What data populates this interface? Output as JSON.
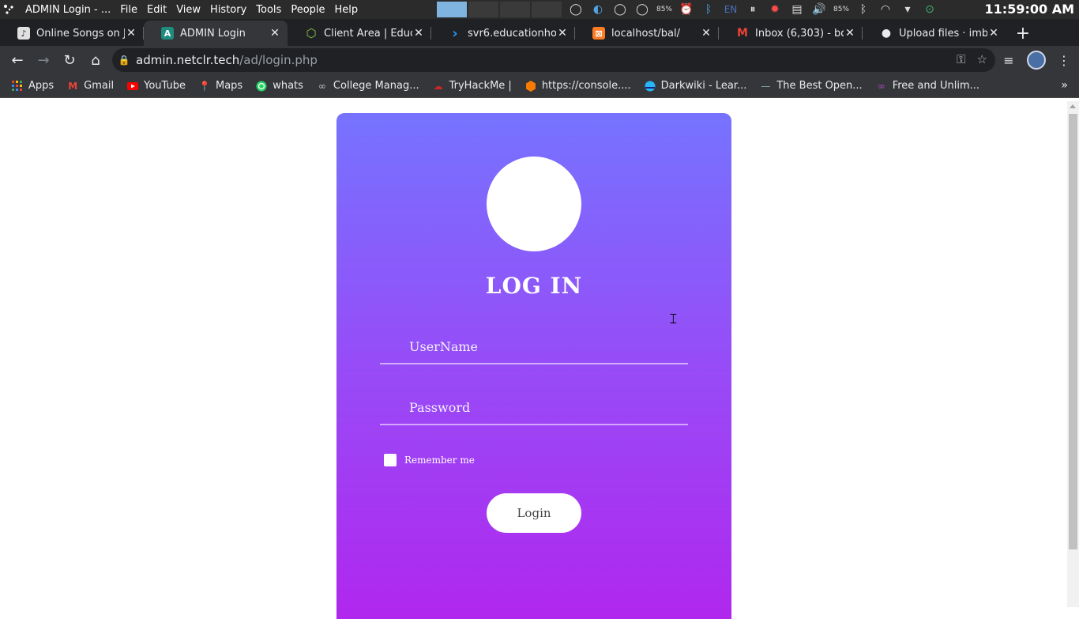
{
  "os": {
    "window_title": "ADMIN Login - ...",
    "menu": [
      "File",
      "Edit",
      "View",
      "History",
      "Tools",
      "People",
      "Help"
    ],
    "clock": "11:59:00 AM",
    "lang": "EN",
    "battery_percent_1": "85%",
    "battery_percent_2": "85%"
  },
  "tabs": [
    {
      "title": "Online Songs on Ji",
      "active": false,
      "favicon_color": "#e0e0e0",
      "favicon": "♪"
    },
    {
      "title": "ADMIN Login",
      "active": true,
      "favicon_color": "#1e8c7e",
      "favicon": "A"
    },
    {
      "title": "Client Area | Educ",
      "active": false,
      "favicon_color": "#8bc34a",
      "favicon": "⬡"
    },
    {
      "title": "svr6.educationhos",
      "active": false,
      "favicon_color": "#2196f3",
      "favicon": "›"
    },
    {
      "title": "localhost/bal/",
      "active": false,
      "favicon_color": "#fb7a24",
      "favicon": "⊠"
    },
    {
      "title": "Inbox (6,303) - bd",
      "active": false,
      "favicon_color": "#ea4335",
      "favicon": "M"
    },
    {
      "title": "Upload files · imb",
      "active": false,
      "favicon_color": "#e8eaed",
      "favicon": "●"
    }
  ],
  "toolbar": {
    "url_host": "admin.netclr.tech",
    "url_path": "/ad/login.php"
  },
  "bookmarks": [
    {
      "label": "Apps",
      "icon": "apps-grid-icon",
      "color": "#ea4335"
    },
    {
      "label": "Gmail",
      "icon": "gmail-icon",
      "color": "#ea4335"
    },
    {
      "label": "YouTube",
      "icon": "youtube-icon",
      "color": "#ff0000"
    },
    {
      "label": "Maps",
      "icon": "maps-icon",
      "color": "#34a853"
    },
    {
      "label": "whats",
      "icon": "whatsapp-icon",
      "color": "#25d366"
    },
    {
      "label": "College Manag...",
      "icon": "link-icon",
      "color": "#bdc1c6"
    },
    {
      "label": "TryHackMe |",
      "icon": "tryhackme-icon",
      "color": "#c62828"
    },
    {
      "label": "https://console....",
      "icon": "aws-icon",
      "color": "#f57c00"
    },
    {
      "label": "Darkwiki - Lear...",
      "icon": "darkwiki-icon",
      "color": "#29b6f6"
    },
    {
      "label": "The Best Open...",
      "icon": "site-icon",
      "color": "#90a4ae"
    },
    {
      "label": "Free and Unlim...",
      "icon": "infinity-icon",
      "color": "#ab47bc"
    }
  ],
  "login": {
    "title": "LOG IN",
    "username_placeholder": "UserName",
    "password_placeholder": "Password",
    "remember_label": "Remember me",
    "button_label": "Login",
    "gradient_top": "#7673ff",
    "gradient_bottom": "#b027ee"
  }
}
